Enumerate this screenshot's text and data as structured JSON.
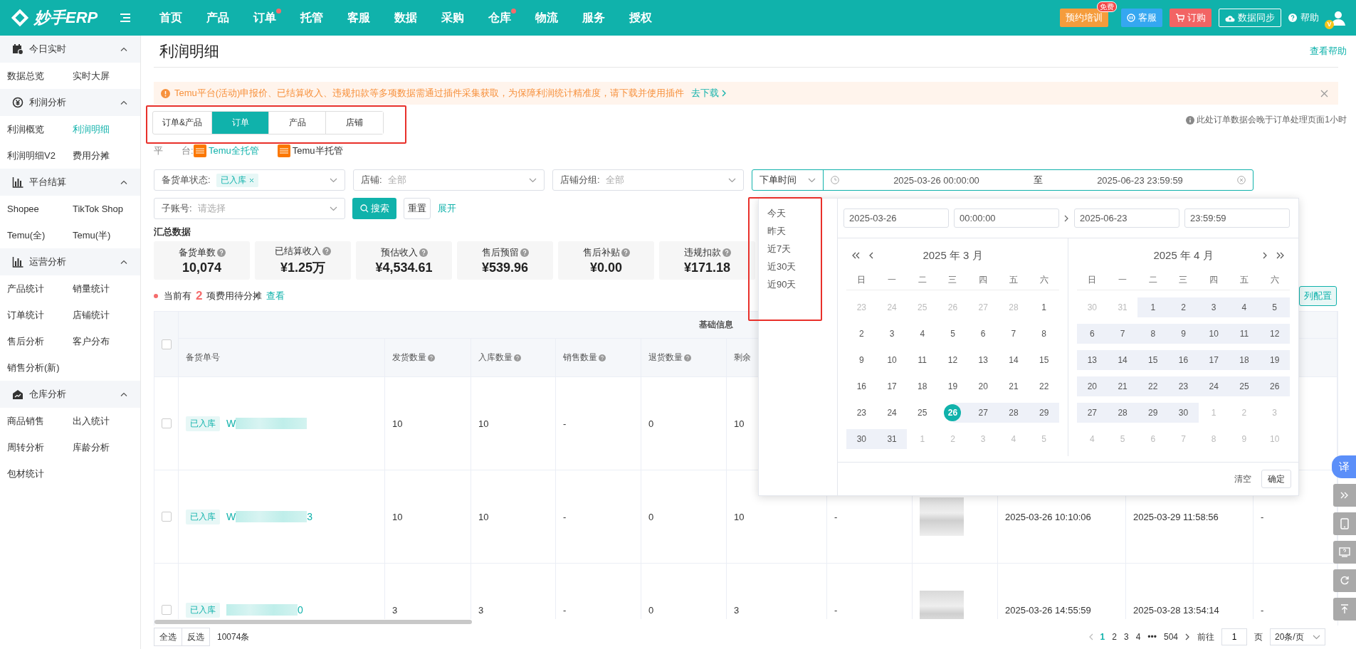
{
  "top_bar": {
    "logo": "妙手ERP",
    "nav": [
      {
        "label": "首页",
        "dot": false
      },
      {
        "label": "产品",
        "dot": false
      },
      {
        "label": "订单",
        "dot": true
      },
      {
        "label": "托管",
        "dot": false
      },
      {
        "label": "客服",
        "dot": false
      },
      {
        "label": "数据",
        "dot": false
      },
      {
        "label": "采购",
        "dot": false
      },
      {
        "label": "仓库",
        "dot": true
      },
      {
        "label": "物流",
        "dot": false
      },
      {
        "label": "服务",
        "dot": false
      },
      {
        "label": "授权",
        "dot": false
      }
    ],
    "actions": [
      {
        "kind": "training",
        "label": "预约培训",
        "badge": "免费"
      },
      {
        "kind": "service",
        "label": "客服"
      },
      {
        "kind": "order",
        "label": "订购"
      },
      {
        "kind": "sync",
        "label": "数据同步"
      },
      {
        "kind": "help",
        "label": "帮助"
      }
    ],
    "avatar_badge": "V"
  },
  "sidebar": {
    "groups": [
      {
        "title": "今日实时",
        "expanded": true,
        "items": [
          {
            "label": "数据总览",
            "selected": false
          },
          {
            "label": "实时大屏",
            "selected": false
          }
        ]
      },
      {
        "title": "利润分析",
        "expanded": true,
        "items": [
          {
            "label": "利润概览",
            "selected": false
          },
          {
            "label": "利润明细",
            "selected": true
          },
          {
            "label": "利润明细V2",
            "selected": false
          },
          {
            "label": "费用分摊",
            "selected": false
          }
        ]
      },
      {
        "title": "平台结算",
        "expanded": true,
        "items": [
          {
            "label": "Shopee",
            "selected": false
          },
          {
            "label": "TikTok Shop",
            "selected": false
          },
          {
            "label": "Temu(全)",
            "selected": false
          },
          {
            "label": "Temu(半)",
            "selected": false
          }
        ]
      },
      {
        "title": "运营分析",
        "expanded": true,
        "items": [
          {
            "label": "产品统计",
            "selected": false
          },
          {
            "label": "销量统计",
            "selected": false
          },
          {
            "label": "订单统计",
            "selected": false
          },
          {
            "label": "店铺统计",
            "selected": false
          },
          {
            "label": "售后分析",
            "selected": false
          },
          {
            "label": "客户分布",
            "selected": false
          },
          {
            "label": "销售分析(新)",
            "selected": false
          }
        ]
      },
      {
        "title": "仓库分析",
        "expanded": true,
        "items": [
          {
            "label": "商品销售",
            "selected": false
          },
          {
            "label": "出入统计",
            "selected": false
          },
          {
            "label": "周转分析",
            "selected": false
          },
          {
            "label": "库龄分析",
            "selected": false
          },
          {
            "label": "包材统计",
            "selected": false
          }
        ]
      }
    ]
  },
  "page": {
    "title": "利润明细",
    "help_link": "查看帮助"
  },
  "notice": {
    "text": "Temu平台(活动)申报价、已结算收入、违规扣款等多项数据需通过插件采集获取，为保障利润统计精准度，请下载并使用插件",
    "link": "去下载"
  },
  "view_tabs": {
    "label": "订单&产品",
    "tabs": [
      {
        "label": "订单",
        "selected": true
      },
      {
        "label": "产品",
        "selected": false
      },
      {
        "label": "店铺",
        "selected": false
      }
    ]
  },
  "data_note": "此处订单数据会晚于订单处理页面1小时",
  "platform": {
    "label": "平　　台:",
    "options": [
      {
        "label": "Temu全托管",
        "selected": true
      },
      {
        "label": "Temu半托管",
        "selected": false
      }
    ]
  },
  "filters": [
    {
      "label": "备货单状态:",
      "tag": "已入库"
    },
    {
      "label": "店铺:",
      "placeholder": "全部"
    },
    {
      "label": "店铺分组:",
      "placeholder": "全部"
    }
  ],
  "date_filter": {
    "type": "下单时间",
    "start": "2025-03-26 00:00:00",
    "separator": "至",
    "end": "2025-06-23 23:59:59"
  },
  "sub_account": {
    "label": "子账号:",
    "placeholder": "请选择"
  },
  "buttons": {
    "search": "搜索",
    "reset": "重置",
    "expand": "展开"
  },
  "summary": {
    "title": "汇总数据",
    "cards": [
      {
        "label": "备货单数",
        "value": "10,074"
      },
      {
        "label": "已结算收入",
        "value": "¥1.25万"
      },
      {
        "label": "预估收入",
        "value": "¥4,534.61"
      },
      {
        "label": "售后预留",
        "value": "¥539.96"
      },
      {
        "label": "售后补贴",
        "value": "¥0.00"
      },
      {
        "label": "违规扣款",
        "value": "¥171.18"
      }
    ]
  },
  "pending": {
    "prefix": "当前有",
    "count": "2",
    "suffix": "项费用待分摊",
    "link": "查看"
  },
  "column_config": "列配置",
  "table": {
    "group_header": "基础信息",
    "all_checked": false,
    "order_column": "备货单号",
    "columns": [
      {
        "label": "发货数量",
        "help": true
      },
      {
        "label": "入库数量",
        "help": true
      },
      {
        "label": "销售数量",
        "help": true
      },
      {
        "label": "退货数量",
        "help": true
      },
      {
        "label": "剩余",
        "help": false
      }
    ],
    "rows": [
      {
        "checked": false,
        "status": "已入库",
        "order_prefix": "W",
        "order_suffix": "",
        "cells": [
          "10",
          "10",
          "-",
          "0",
          "10"
        ]
      },
      {
        "checked": false,
        "status": "已入库",
        "order_prefix": "W",
        "order_suffix": "3",
        "cells": [
          "10",
          "10",
          "-",
          "0",
          "10",
          "-",
          "2025-03-26 10:10:06",
          "2025-03-29 11:58:56",
          "-"
        ]
      },
      {
        "checked": false,
        "status": "已入库",
        "order_prefix": "",
        "order_suffix": "0",
        "cells": [
          "3",
          "3",
          "-",
          "0",
          "3",
          "-",
          "2025-03-26 14:55:59",
          "2025-03-28 13:54:14",
          "-"
        ]
      }
    ]
  },
  "footer": {
    "select_all": "全选",
    "invert": "反选",
    "total": "10074条",
    "pages": [
      {
        "label": "1",
        "selected": true
      },
      {
        "label": "2",
        "selected": false
      },
      {
        "label": "3",
        "selected": false
      },
      {
        "label": "4",
        "selected": false
      }
    ],
    "ellipsis": "•••",
    "last_page": "504",
    "goto_label": "前往",
    "goto_value": "1",
    "page_unit": "页",
    "page_size": "20条/页"
  },
  "date_picker": {
    "shortcuts": [
      "今天",
      "昨天",
      "近7天",
      "近30天",
      "近90天"
    ],
    "start_date": "2025-03-26",
    "start_time": "00:00:00",
    "end_date": "2025-06-23",
    "end_time": "23:59:59",
    "clear": "清空",
    "confirm": "确定",
    "months": [
      {
        "title": "2025 年 3 月",
        "weekdays": [
          "日",
          "一",
          "二",
          "三",
          "四",
          "五",
          "六"
        ],
        "weeks": [
          [
            {
              "d": "23",
              "kind": "other"
            },
            {
              "d": "24",
              "kind": "other"
            },
            {
              "d": "25",
              "kind": "other"
            },
            {
              "d": "26",
              "kind": "other"
            },
            {
              "d": "27",
              "kind": "other"
            },
            {
              "d": "28",
              "kind": "other"
            },
            {
              "d": "1",
              "kind": "plain"
            }
          ],
          [
            {
              "d": "2",
              "kind": "plain"
            },
            {
              "d": "3",
              "kind": "plain"
            },
            {
              "d": "4",
              "kind": "plain"
            },
            {
              "d": "5",
              "kind": "plain"
            },
            {
              "d": "6",
              "kind": "plain"
            },
            {
              "d": "7",
              "kind": "plain"
            },
            {
              "d": "8",
              "kind": "plain"
            }
          ],
          [
            {
              "d": "9",
              "kind": "plain"
            },
            {
              "d": "10",
              "kind": "plain"
            },
            {
              "d": "11",
              "kind": "plain"
            },
            {
              "d": "12",
              "kind": "plain"
            },
            {
              "d": "13",
              "kind": "plain"
            },
            {
              "d": "14",
              "kind": "plain"
            },
            {
              "d": "15",
              "kind": "plain"
            }
          ],
          [
            {
              "d": "16",
              "kind": "plain"
            },
            {
              "d": "17",
              "kind": "plain"
            },
            {
              "d": "18",
              "kind": "plain"
            },
            {
              "d": "19",
              "kind": "plain"
            },
            {
              "d": "20",
              "kind": "plain"
            },
            {
              "d": "21",
              "kind": "plain"
            },
            {
              "d": "22",
              "kind": "plain"
            }
          ],
          [
            {
              "d": "23",
              "kind": "plain"
            },
            {
              "d": "24",
              "kind": "plain"
            },
            {
              "d": "25",
              "kind": "plain"
            },
            {
              "d": "26",
              "kind": "start"
            },
            {
              "d": "27",
              "kind": "range"
            },
            {
              "d": "28",
              "kind": "range"
            },
            {
              "d": "29",
              "kind": "range"
            }
          ],
          [
            {
              "d": "30",
              "kind": "range"
            },
            {
              "d": "31",
              "kind": "range"
            },
            {
              "d": "1",
              "kind": "other"
            },
            {
              "d": "2",
              "kind": "other"
            },
            {
              "d": "3",
              "kind": "other"
            },
            {
              "d": "4",
              "kind": "other"
            },
            {
              "d": "5",
              "kind": "other"
            }
          ]
        ]
      },
      {
        "title": "2025 年 4 月",
        "weekdays": [
          "日",
          "一",
          "二",
          "三",
          "四",
          "五",
          "六"
        ],
        "weeks": [
          [
            {
              "d": "30",
              "kind": "other"
            },
            {
              "d": "31",
              "kind": "other"
            },
            {
              "d": "1",
              "kind": "range"
            },
            {
              "d": "2",
              "kind": "range"
            },
            {
              "d": "3",
              "kind": "range"
            },
            {
              "d": "4",
              "kind": "range"
            },
            {
              "d": "5",
              "kind": "range"
            }
          ],
          [
            {
              "d": "6",
              "kind": "range"
            },
            {
              "d": "7",
              "kind": "range"
            },
            {
              "d": "8",
              "kind": "range"
            },
            {
              "d": "9",
              "kind": "range"
            },
            {
              "d": "10",
              "kind": "range"
            },
            {
              "d": "11",
              "kind": "range"
            },
            {
              "d": "12",
              "kind": "range"
            }
          ],
          [
            {
              "d": "13",
              "kind": "range"
            },
            {
              "d": "14",
              "kind": "range"
            },
            {
              "d": "15",
              "kind": "range"
            },
            {
              "d": "16",
              "kind": "range"
            },
            {
              "d": "17",
              "kind": "range"
            },
            {
              "d": "18",
              "kind": "range"
            },
            {
              "d": "19",
              "kind": "range"
            }
          ],
          [
            {
              "d": "20",
              "kind": "range"
            },
            {
              "d": "21",
              "kind": "range"
            },
            {
              "d": "22",
              "kind": "range"
            },
            {
              "d": "23",
              "kind": "range"
            },
            {
              "d": "24",
              "kind": "range"
            },
            {
              "d": "25",
              "kind": "range"
            },
            {
              "d": "26",
              "kind": "range"
            }
          ],
          [
            {
              "d": "27",
              "kind": "range"
            },
            {
              "d": "28",
              "kind": "range"
            },
            {
              "d": "29",
              "kind": "range"
            },
            {
              "d": "30",
              "kind": "range"
            },
            {
              "d": "1",
              "kind": "other"
            },
            {
              "d": "2",
              "kind": "other"
            },
            {
              "d": "3",
              "kind": "other"
            }
          ],
          [
            {
              "d": "4",
              "kind": "other"
            },
            {
              "d": "5",
              "kind": "other"
            },
            {
              "d": "6",
              "kind": "other"
            },
            {
              "d": "7",
              "kind": "other"
            },
            {
              "d": "8",
              "kind": "other"
            },
            {
              "d": "9",
              "kind": "other"
            },
            {
              "d": "10",
              "kind": "other"
            }
          ]
        ]
      }
    ]
  },
  "floating_tools": [
    {
      "kind": "translate",
      "label": "译"
    },
    {
      "kind": "collapse"
    },
    {
      "kind": "phone"
    },
    {
      "kind": "help"
    },
    {
      "kind": "refresh"
    },
    {
      "kind": "upload"
    }
  ]
}
